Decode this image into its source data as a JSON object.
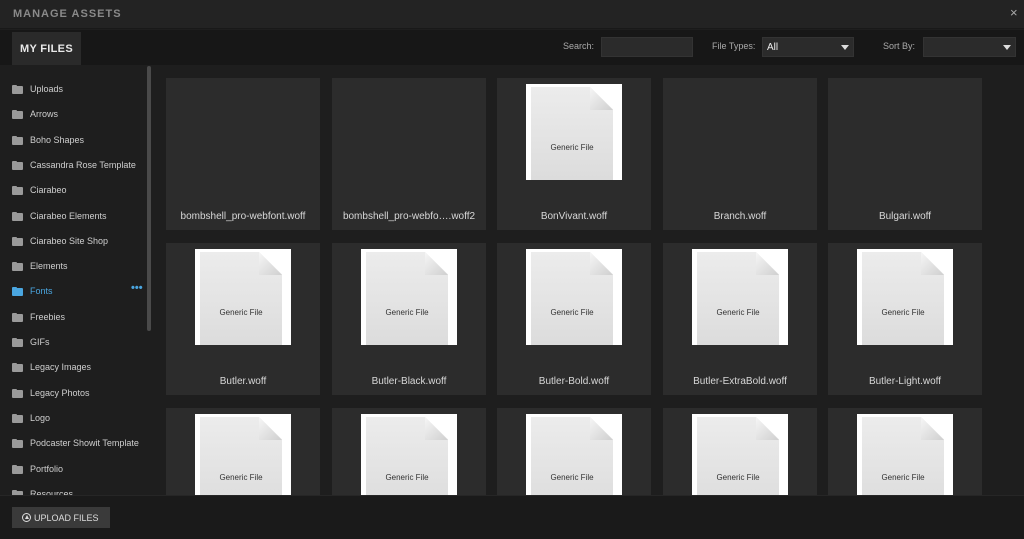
{
  "window": {
    "title": "MANAGE ASSETS",
    "close_glyph": "×"
  },
  "toolbar": {
    "tab_label": "MY FILES",
    "search_label": "Search:",
    "search_value": "",
    "search_placeholder": "",
    "filetypes_label": "File Types:",
    "filetypes_value": "All",
    "sortby_label": "Sort By:",
    "sortby_value": ""
  },
  "sidebar": {
    "items": [
      {
        "label": "Uploads"
      },
      {
        "label": "Arrows"
      },
      {
        "label": "Boho Shapes"
      },
      {
        "label": "Cassandra Rose Template"
      },
      {
        "label": "Ciarabeo"
      },
      {
        "label": "Ciarabeo Elements"
      },
      {
        "label": "Ciarabeo Site Shop"
      },
      {
        "label": "Elements"
      },
      {
        "label": "Fonts",
        "active": true,
        "more": "•••"
      },
      {
        "label": "Freebies"
      },
      {
        "label": "GIFs"
      },
      {
        "label": "Legacy Images"
      },
      {
        "label": "Legacy Photos"
      },
      {
        "label": "Logo"
      },
      {
        "label": "Podcaster Showit Template"
      },
      {
        "label": "Portfolio"
      },
      {
        "label": "Resources"
      }
    ]
  },
  "files": [
    {
      "name": "bombshell_pro-webfont.woff",
      "thumb": false
    },
    {
      "name": "bombshell_pro-webfo….woff2",
      "thumb": false
    },
    {
      "name": "BonVivant.woff",
      "thumb": true,
      "thumb_text": "Generic File"
    },
    {
      "name": "Branch.woff",
      "thumb": false
    },
    {
      "name": "Bulgari.woff",
      "thumb": false
    },
    {
      "name": "Butler.woff",
      "thumb": true,
      "thumb_text": "Generic File"
    },
    {
      "name": "Butler-Black.woff",
      "thumb": true,
      "thumb_text": "Generic File"
    },
    {
      "name": "Butler-Bold.woff",
      "thumb": true,
      "thumb_text": "Generic File"
    },
    {
      "name": "Butler-ExtraBold.woff",
      "thumb": true,
      "thumb_text": "Generic File"
    },
    {
      "name": "Butler-Light.woff",
      "thumb": true,
      "thumb_text": "Generic File"
    },
    {
      "name": "",
      "thumb": true,
      "thumb_text": "Generic File"
    },
    {
      "name": "",
      "thumb": true,
      "thumb_text": "Generic File"
    },
    {
      "name": "",
      "thumb": true,
      "thumb_text": "Generic File"
    },
    {
      "name": "",
      "thumb": true,
      "thumb_text": "Generic File"
    },
    {
      "name": "",
      "thumb": true,
      "thumb_text": "Generic File"
    }
  ],
  "footer": {
    "upload_label": "UPLOAD FILES"
  }
}
